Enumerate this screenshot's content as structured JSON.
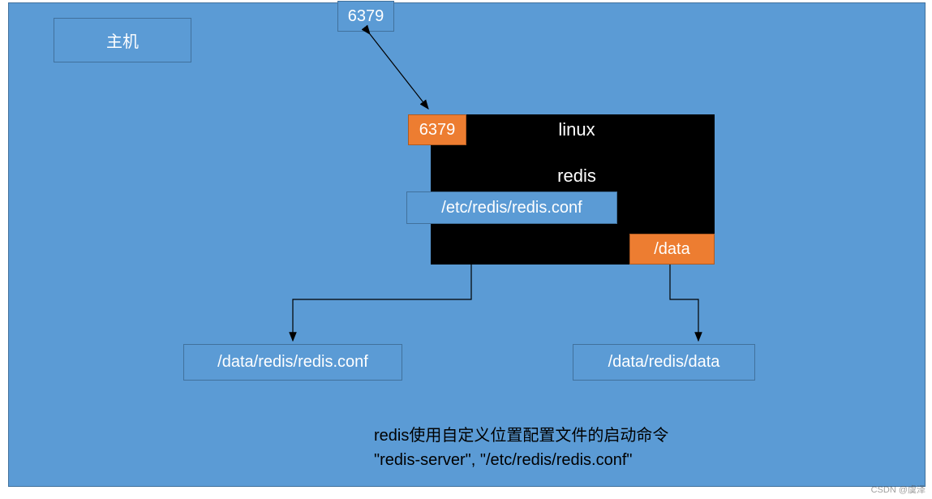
{
  "host_label": "主机",
  "host_port": "6379",
  "container": {
    "port": "6379",
    "os_label": "linux",
    "app_label": "redis",
    "conf_path": "/etc/redis/redis.conf",
    "data_path": "/data"
  },
  "host_mounts": {
    "conf_path": "/data/redis/redis.conf",
    "data_path": "/data/redis/data"
  },
  "caption_line1": "redis使用自定义位置配置文件的启动命令",
  "caption_line2": "\"redis-server\", \"/etc/redis/redis.conf\"",
  "watermark": "CSDN @虞泽"
}
